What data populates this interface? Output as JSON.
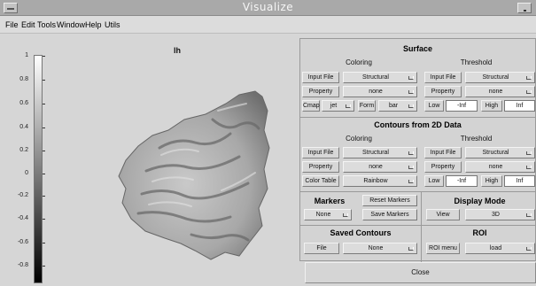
{
  "window": {
    "title": "Visualize"
  },
  "menu": [
    "File",
    "Edit",
    "Tools",
    "Window",
    "Help",
    "Utils"
  ],
  "axes": {
    "title": "lh",
    "colorbar_ticks": [
      "1",
      "0.8",
      "0.6",
      "0.4",
      "0.2",
      "0",
      "-0.2",
      "-0.4",
      "-0.6",
      "-0.8"
    ]
  },
  "surface": {
    "title": "Surface",
    "coloring": {
      "title": "Coloring",
      "input_file_label": "Input File",
      "input_file_value": "Structural",
      "property_label": "Property",
      "property_value": "none",
      "cmap_label": "Cmap",
      "cmap_value": "jet",
      "form_label": "Form",
      "form_value": "bar"
    },
    "threshold": {
      "title": "Threshold",
      "input_file_label": "Input File",
      "input_file_value": "Structural",
      "property_label": "Property",
      "property_value": "none",
      "low_label": "Low",
      "low_value": "-Inf",
      "high_label": "High",
      "high_value": "Inf"
    }
  },
  "contours": {
    "title": "Contours from 2D Data",
    "coloring": {
      "title": "Coloring",
      "input_file_label": "Input File",
      "input_file_value": "Structural",
      "property_label": "Property",
      "property_value": "none",
      "color_table_label": "Color Table",
      "color_table_value": "Rainbow"
    },
    "threshold": {
      "title": "Threshold",
      "input_file_label": "Input File",
      "input_file_value": "Structural",
      "property_label": "Property",
      "property_value": "none",
      "low_label": "Low",
      "low_value": "-Inf",
      "high_label": "High",
      "high_value": "Inf"
    }
  },
  "markers": {
    "title": "Markers",
    "value": "None",
    "reset_label": "Reset Markers",
    "save_label": "Save Markers"
  },
  "display_mode": {
    "title": "Display Mode",
    "view_label": "View",
    "view_value": "3D"
  },
  "saved_contours": {
    "title": "Saved Contours",
    "file_label": "File",
    "file_value": "None"
  },
  "roi": {
    "title": "ROI",
    "menu_label": "ROI menu",
    "menu_value": "load"
  },
  "close_label": "Close"
}
